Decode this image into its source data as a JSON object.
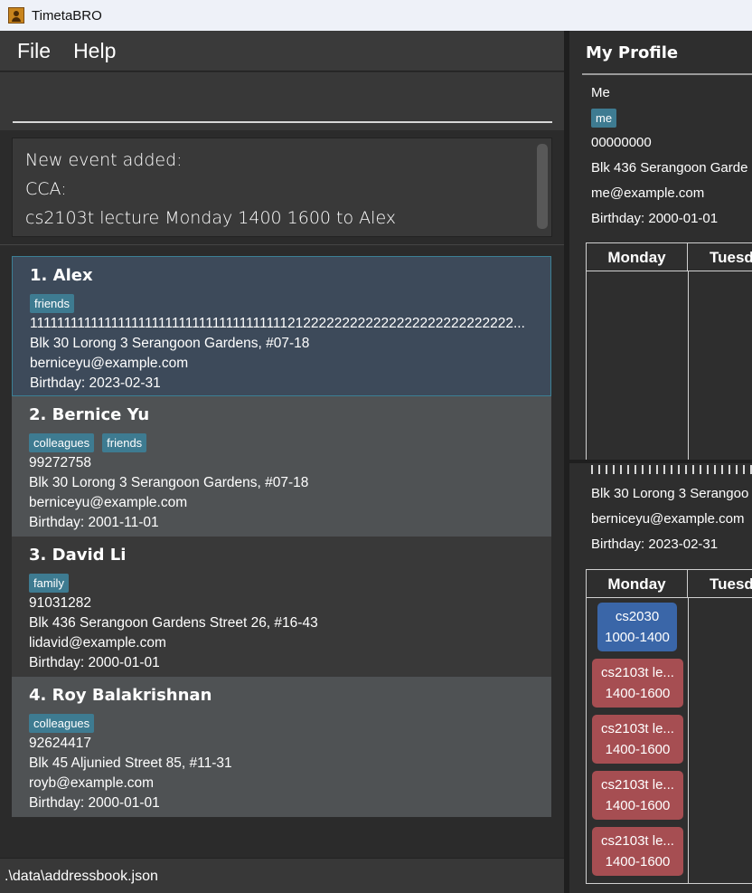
{
  "window": {
    "title": "TimetaBRO"
  },
  "menu": {
    "items": [
      "File",
      "Help"
    ]
  },
  "command": {
    "value": "",
    "placeholder": ""
  },
  "result": {
    "lines": [
      "New event added:",
      "CCA:",
      "cs2103t lecture Monday 1400 1600 to Alex"
    ]
  },
  "persons": [
    {
      "index": "1.",
      "name": "Alex",
      "tags": [
        "friends"
      ],
      "phone": "1111111111111111111111111111111111111121222222222222222222222222222...",
      "address": "Blk 30 Lorong 3 Serangoon Gardens, #07-18",
      "email": "berniceyu@example.com",
      "birthday": "Birthday: 2023-02-31",
      "selected": true
    },
    {
      "index": "2.",
      "name": "Bernice Yu",
      "tags": [
        "colleagues",
        "friends"
      ],
      "phone": "99272758",
      "address": "Blk 30 Lorong 3 Serangoon Gardens, #07-18",
      "email": "berniceyu@example.com",
      "birthday": "Birthday: 2001-11-01"
    },
    {
      "index": "3.",
      "name": "David Li",
      "tags": [
        "family"
      ],
      "phone": "91031282",
      "address": "Blk 436 Serangoon Gardens Street 26, #16-43",
      "email": "lidavid@example.com",
      "birthday": "Birthday: 2000-01-01"
    },
    {
      "index": "4.",
      "name": "Roy Balakrishnan",
      "tags": [
        "colleagues"
      ],
      "phone": "92624417",
      "address": "Blk 45 Aljunied Street 85, #11-31",
      "email": "royb@example.com",
      "birthday": "Birthday: 2000-01-01"
    }
  ],
  "status": {
    "path": ".\\data\\addressbook.json"
  },
  "profile": {
    "title": "My Profile",
    "name": "Me",
    "tag": "me",
    "phone": "00000000",
    "address": "Blk 436 Serangoon Garde",
    "email": "me@example.com",
    "birthday": "Birthday: 2000-01-01",
    "timetable": {
      "col1": "Monday",
      "col2": "Tuesd"
    }
  },
  "detail": {
    "address": "Blk 30 Lorong 3 Serangoo",
    "email": "berniceyu@example.com",
    "birthday": "Birthday: 2023-02-31",
    "timetable": {
      "col1": "Monday",
      "col2": "Tuesd",
      "events": [
        {
          "name": "cs2030",
          "time": "1000-1400",
          "color": "#3a66a8"
        },
        {
          "name": "cs2103t le...",
          "time": "1400-1600",
          "color": "#a64e52"
        },
        {
          "name": "cs2103t le...",
          "time": "1400-1600",
          "color": "#a64e52"
        },
        {
          "name": "cs2103t le...",
          "time": "1400-1600",
          "color": "#a64e52"
        },
        {
          "name": "cs2103t le...",
          "time": "1400-1600",
          "color": "#a64e52"
        }
      ]
    }
  },
  "icons": {
    "app": "contact-book-icon"
  }
}
